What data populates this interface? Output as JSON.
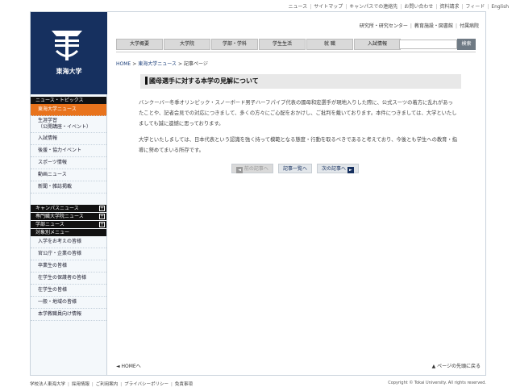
{
  "top_links": [
    "ニュース",
    "サイトマップ",
    "キャンパスでの連絡先",
    "お問い合わせ",
    "資料請求",
    "フィード",
    "English"
  ],
  "logo": {
    "text": "東海大学",
    "icon": "tokai-university-logo"
  },
  "util_links": [
    "研究所・研究センター",
    "教育施設・図書館",
    "付属病院"
  ],
  "nav": [
    "大学概要",
    "大学院",
    "学部・学科",
    "学生生活",
    "就 職",
    "入試情報"
  ],
  "search": {
    "button": "検索",
    "value": ""
  },
  "sidebar": {
    "news_heading": "ニュース・トピックス",
    "news_items": [
      {
        "label": "東海大学ニュース"
      },
      {
        "label": "生涯学習\n（公開講座・イベント）"
      },
      {
        "label": "入試情報"
      },
      {
        "label": "後援・協力イベント"
      },
      {
        "label": "スポーツ情報"
      },
      {
        "label": "動画ニュース"
      },
      {
        "label": "新聞・雑誌掲載"
      }
    ],
    "campus_heading": "キャンパスニュース",
    "grad_heading": "専門職大学院ニュース",
    "faculty_heading": "学部ニュース",
    "audience_heading": "対象別メニュー",
    "audience_items": [
      {
        "label": "入学をお考えの皆様"
      },
      {
        "label": "官公庁・企業の皆様"
      },
      {
        "label": "卒業生の皆様"
      },
      {
        "label": "在学生の保護者の皆様"
      },
      {
        "label": "在学生の皆様"
      },
      {
        "label": "一般・地域の皆様"
      },
      {
        "label": "本学教職員向け情報"
      }
    ]
  },
  "breadcrumb": {
    "home": "HOME",
    "news": "東海大学ニュース",
    "current": "記事ページ"
  },
  "article": {
    "title": "國母選手に対する本学の見解について",
    "paragraph1": "バンクーバー冬季オリンピック・スノーボード男子ハーフパイプ代表の國母和宏選手が現地入りした際に、公式スーツの着方に乱れがあったことや、記者会見での対応につきまして、多くの方々にご心配をおかけし、ご批判を戴いております。本件につきましては、大学といたしましても誠に遺憾に思っております。",
    "paragraph2": "大学といたしましては、日本代表という認識を強く持って模範となる態度・行動を取るべきであると考えており、今後とも学生への教育・指導に努めてまいる所存です。"
  },
  "pager": {
    "prev": "前の記事へ",
    "list": "記事一覧へ",
    "next": "次の記事へ"
  },
  "bottom": {
    "home": "◄ HOMEへ",
    "page_top": "▲ ページの先頭に戻る"
  },
  "footer": {
    "links": [
      "学校法人東海大学",
      "採用情報",
      "ご利用案内",
      "プライバシーポリシー",
      "免責事項"
    ],
    "copyright": "Copyright © Tokai University. All rights reserved."
  }
}
